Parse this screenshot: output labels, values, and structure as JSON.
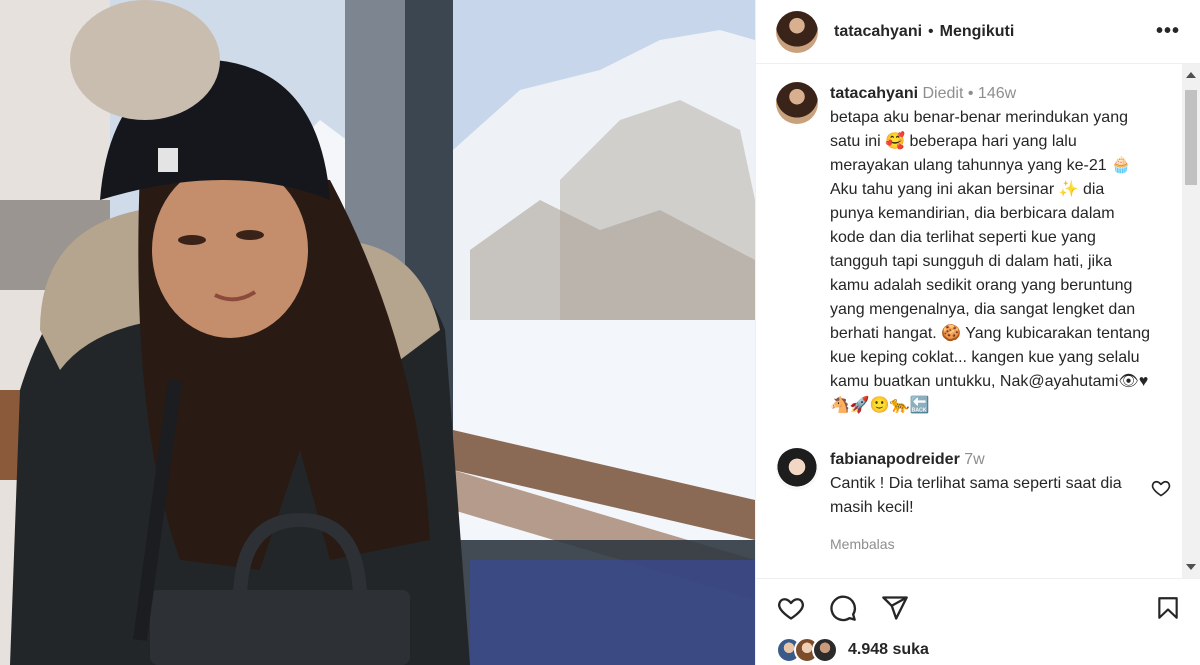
{
  "header": {
    "username": "tatacahyani",
    "separator": "•",
    "follow_status": "Mengikuti",
    "more_label": "•••"
  },
  "post": {
    "username": "tatacahyani",
    "edited": "Diedit",
    "dot": "•",
    "age": "146w",
    "caption": "betapa aku benar-benar merindukan yang satu ini 🥰 beberapa hari yang lalu merayakan ulang tahunnya yang ke-21 🧁 Aku tahu yang ini akan bersinar ✨ dia punya kemandirian, dia berbicara dalam kode dan dia terlihat seperti kue yang tangguh tapi sungguh di dalam hati, jika kamu adalah sedikit orang yang beruntung yang mengenalnya, dia sangat lengket dan berhati hangat. 🍪 Yang kubicarakan tentang kue keping coklat... kangen kue yang selalu kamu buatkan untukku, Nak@ayahutami👁♥🐴🚀🙂🐆🔙"
  },
  "comment": {
    "username": "fabianapodreider",
    "age": "7w",
    "text": "Cantik ! Dia terlihat sama seperti saat dia masih kecil!",
    "reply_label": "Membalas"
  },
  "actions": {
    "likes": "4.948 suka",
    "icons": [
      "heart-icon",
      "comment-icon",
      "share-icon",
      "bookmark-icon"
    ]
  },
  "colors": {
    "text": "#262626",
    "muted": "#8e8e8e",
    "border": "#efefef"
  }
}
